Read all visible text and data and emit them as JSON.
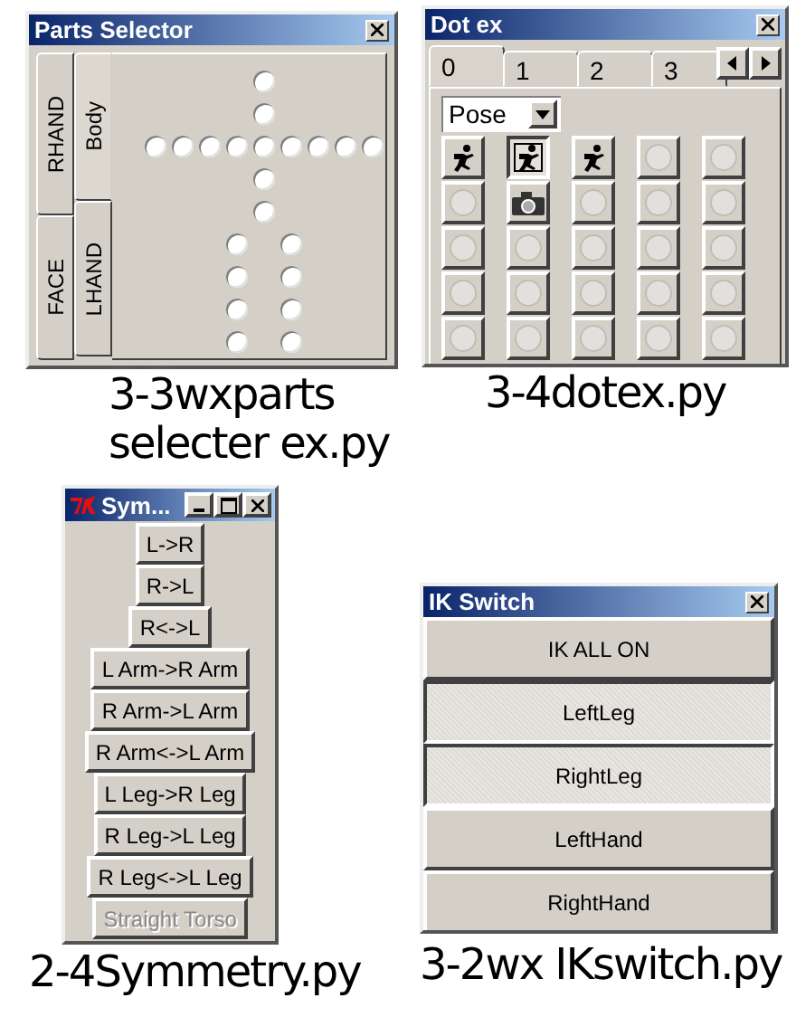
{
  "windows": [
    {
      "kind": "parts_selector",
      "title": "Parts Selector",
      "side_tabs": [
        {
          "label": "RHAND",
          "selected": false
        },
        {
          "label": "FACE",
          "selected": false
        },
        {
          "label": "Body",
          "selected": true
        },
        {
          "label": "LHAND",
          "selected": false
        }
      ],
      "radios": [
        {
          "checked": false
        },
        {
          "checked": false
        },
        {
          "checked": false
        },
        {
          "checked": false
        },
        {
          "checked": false
        },
        {
          "checked": false
        },
        {
          "checked": false
        },
        {
          "checked": false
        },
        {
          "checked": false
        },
        {
          "checked": false
        },
        {
          "checked": false
        },
        {
          "checked": false
        },
        {
          "checked": false
        },
        {
          "checked": false
        },
        {
          "checked": false
        },
        {
          "checked": false
        },
        {
          "checked": false
        },
        {
          "checked": false
        },
        {
          "checked": false
        },
        {
          "checked": false
        },
        {
          "checked": false
        }
      ],
      "caption": [
        "3-3wxparts",
        "selecter ex.py"
      ]
    },
    {
      "kind": "dot_ex",
      "title": "Dot ex",
      "tabs": [
        {
          "label": "0",
          "selected": true
        },
        {
          "label": "1",
          "selected": false
        },
        {
          "label": "2",
          "selected": false
        },
        {
          "label": "3",
          "selected": false
        }
      ],
      "dropdown": {
        "value": "Pose"
      },
      "slots": [
        {
          "kind": "runner",
          "focused": false
        },
        {
          "kind": "runner",
          "focused": true
        },
        {
          "kind": "runner",
          "focused": false
        },
        {
          "kind": "empty",
          "focused": false
        },
        {
          "kind": "empty",
          "focused": false
        },
        {
          "kind": "empty",
          "focused": false
        },
        {
          "kind": "camera",
          "focused": false
        },
        {
          "kind": "empty",
          "focused": false
        },
        {
          "kind": "empty",
          "focused": false
        },
        {
          "kind": "empty",
          "focused": false
        },
        {
          "kind": "empty",
          "focused": false
        },
        {
          "kind": "empty",
          "focused": false
        },
        {
          "kind": "empty",
          "focused": false
        },
        {
          "kind": "empty",
          "focused": false
        },
        {
          "kind": "empty",
          "focused": false
        },
        {
          "kind": "empty",
          "focused": false
        },
        {
          "kind": "empty",
          "focused": false
        },
        {
          "kind": "empty",
          "focused": false
        },
        {
          "kind": "empty",
          "focused": false
        },
        {
          "kind": "empty",
          "focused": false
        },
        {
          "kind": "empty",
          "focused": false
        },
        {
          "kind": "empty",
          "focused": false
        },
        {
          "kind": "empty",
          "focused": false
        },
        {
          "kind": "empty",
          "focused": false
        },
        {
          "kind": "empty",
          "focused": false
        }
      ],
      "caption": [
        "3-4dotex.py"
      ]
    },
    {
      "kind": "symmetry",
      "title": "Sym...",
      "buttons": [
        {
          "label": "L->R",
          "disabled": false
        },
        {
          "label": "R->L",
          "disabled": false
        },
        {
          "label": "R<->L",
          "disabled": false
        },
        {
          "label": "L Arm->R Arm",
          "disabled": false
        },
        {
          "label": "R Arm->L Arm",
          "disabled": false
        },
        {
          "label": "R Arm<->L Arm",
          "disabled": false
        },
        {
          "label": "L Leg->R Leg",
          "disabled": false
        },
        {
          "label": "R Leg->L Leg",
          "disabled": false
        },
        {
          "label": "R Leg<->L Leg",
          "disabled": false
        },
        {
          "label": "Straight Torso",
          "disabled": true
        }
      ],
      "caption": [
        "2-4Symmetry.py"
      ]
    },
    {
      "kind": "ik_switch",
      "title": "IK Switch",
      "buttons": [
        {
          "label": "IK ALL ON",
          "pressed": false
        },
        {
          "label": "LeftLeg",
          "pressed": true
        },
        {
          "label": "RightLeg",
          "pressed": true
        },
        {
          "label": "LeftHand",
          "pressed": false
        },
        {
          "label": "RightHand",
          "pressed": false
        }
      ],
      "caption": [
        "3-2wx IKswitch.py"
      ]
    }
  ]
}
